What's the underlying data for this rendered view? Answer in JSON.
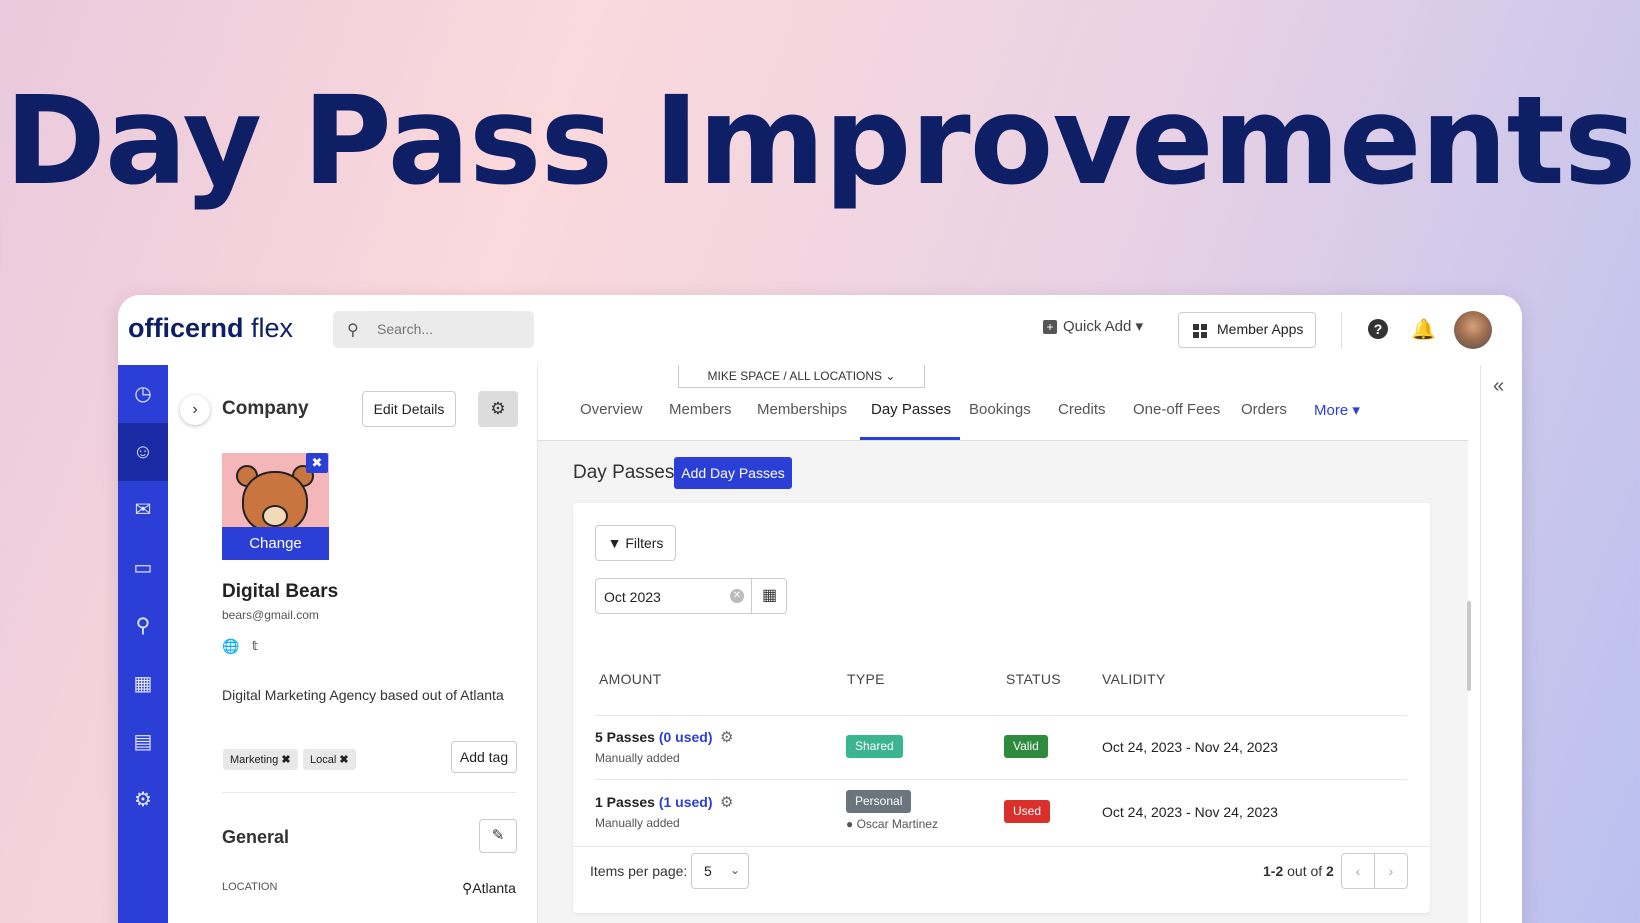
{
  "hero": {
    "title": "Day Pass Improvements"
  },
  "topbar": {
    "logo_main": "officernd",
    "logo_sub": " flex",
    "search_placeholder": "Search...",
    "quick_add": "Quick Add",
    "member_apps": "Member Apps"
  },
  "sidebar": {
    "items": [
      "dashboard-icon",
      "members-icon",
      "chat-icon",
      "billing-icon",
      "location-icon",
      "calendar-icon",
      "reports-icon",
      "settings-icon"
    ],
    "active_index": 1
  },
  "company": {
    "heading": "Company",
    "edit_details": "Edit Details",
    "change": "Change",
    "name": "Digital Bears",
    "email": "bears@gmail.com",
    "description": "Digital Marketing Agency based out of Atlanta",
    "tags": [
      "Marketing",
      "Local"
    ],
    "add_tag": "Add tag",
    "general": "General",
    "location_label": "LOCATION",
    "location_value": "Atlanta"
  },
  "location_selector": {
    "space": "MIKE SPACE",
    "sep": "/",
    "locations": "ALL LOCATIONS"
  },
  "tabs": [
    "Overview",
    "Members",
    "Memberships",
    "Day Passes",
    "Bookings",
    "Credits",
    "One-off Fees",
    "Orders",
    "More"
  ],
  "active_tab": "Day Passes",
  "day_passes": {
    "heading": "Day Passes",
    "add_button": "Add Day Passes",
    "filters": "Filters",
    "date_value": "Oct 2023",
    "columns": [
      "AMOUNT",
      "TYPE",
      "STATUS",
      "VALIDITY"
    ],
    "rows": [
      {
        "amount": "5 Passes",
        "used": "(0 used)",
        "source": "Manually added",
        "type": "Shared",
        "type_color": "#3bb58f",
        "status": "Valid",
        "status_color": "#2e8b3d",
        "owner": "",
        "validity": "Oct 24, 2023 - Nov 24, 2023"
      },
      {
        "amount": "1 Passes",
        "used": "(1 used)",
        "source": "Manually added",
        "type": "Personal",
        "type_color": "#6c757d",
        "status": "Used",
        "status_color": "#d9302c",
        "owner": "Oscar Martinez",
        "validity": "Oct 24, 2023 - Nov 24, 2023"
      }
    ],
    "items_per_page_label": "Items per page:",
    "items_per_page": "5",
    "range": "1-2",
    "out_of": " out of ",
    "total": "2"
  }
}
